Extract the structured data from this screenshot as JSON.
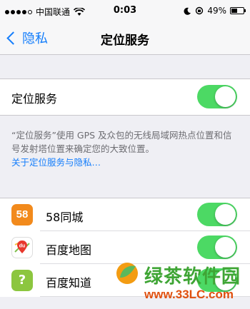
{
  "status_bar": {
    "carrier": "中国联通",
    "time": "0:03",
    "battery": "49%",
    "battery_level": 0.49
  },
  "nav": {
    "back_label": "隐私",
    "title": "定位服务"
  },
  "location_services": {
    "label": "定位服务",
    "enabled": true
  },
  "footer": {
    "text": "“定位服务”使用 GPS 及众包的无线局域网热点位置和信号发射塔位置来确定您的大致位置。",
    "link": "关于定位服务与隐私…"
  },
  "apps": [
    {
      "name": "58同城",
      "icon": "58-app-icon",
      "icon_text": "58",
      "enabled": true
    },
    {
      "name": "百度地图",
      "icon": "baidu-map-icon",
      "icon_text": "du",
      "enabled": true
    },
    {
      "name": "百度知道",
      "icon": "baidu-zhidao-icon",
      "icon_text": "?",
      "enabled": true
    }
  ],
  "watermark": {
    "title": "绿茶软件园",
    "url": "www.33LC.com"
  },
  "colors": {
    "accent": "#157efb",
    "toggle_on": "#4cd964",
    "background": "#efeff4"
  }
}
